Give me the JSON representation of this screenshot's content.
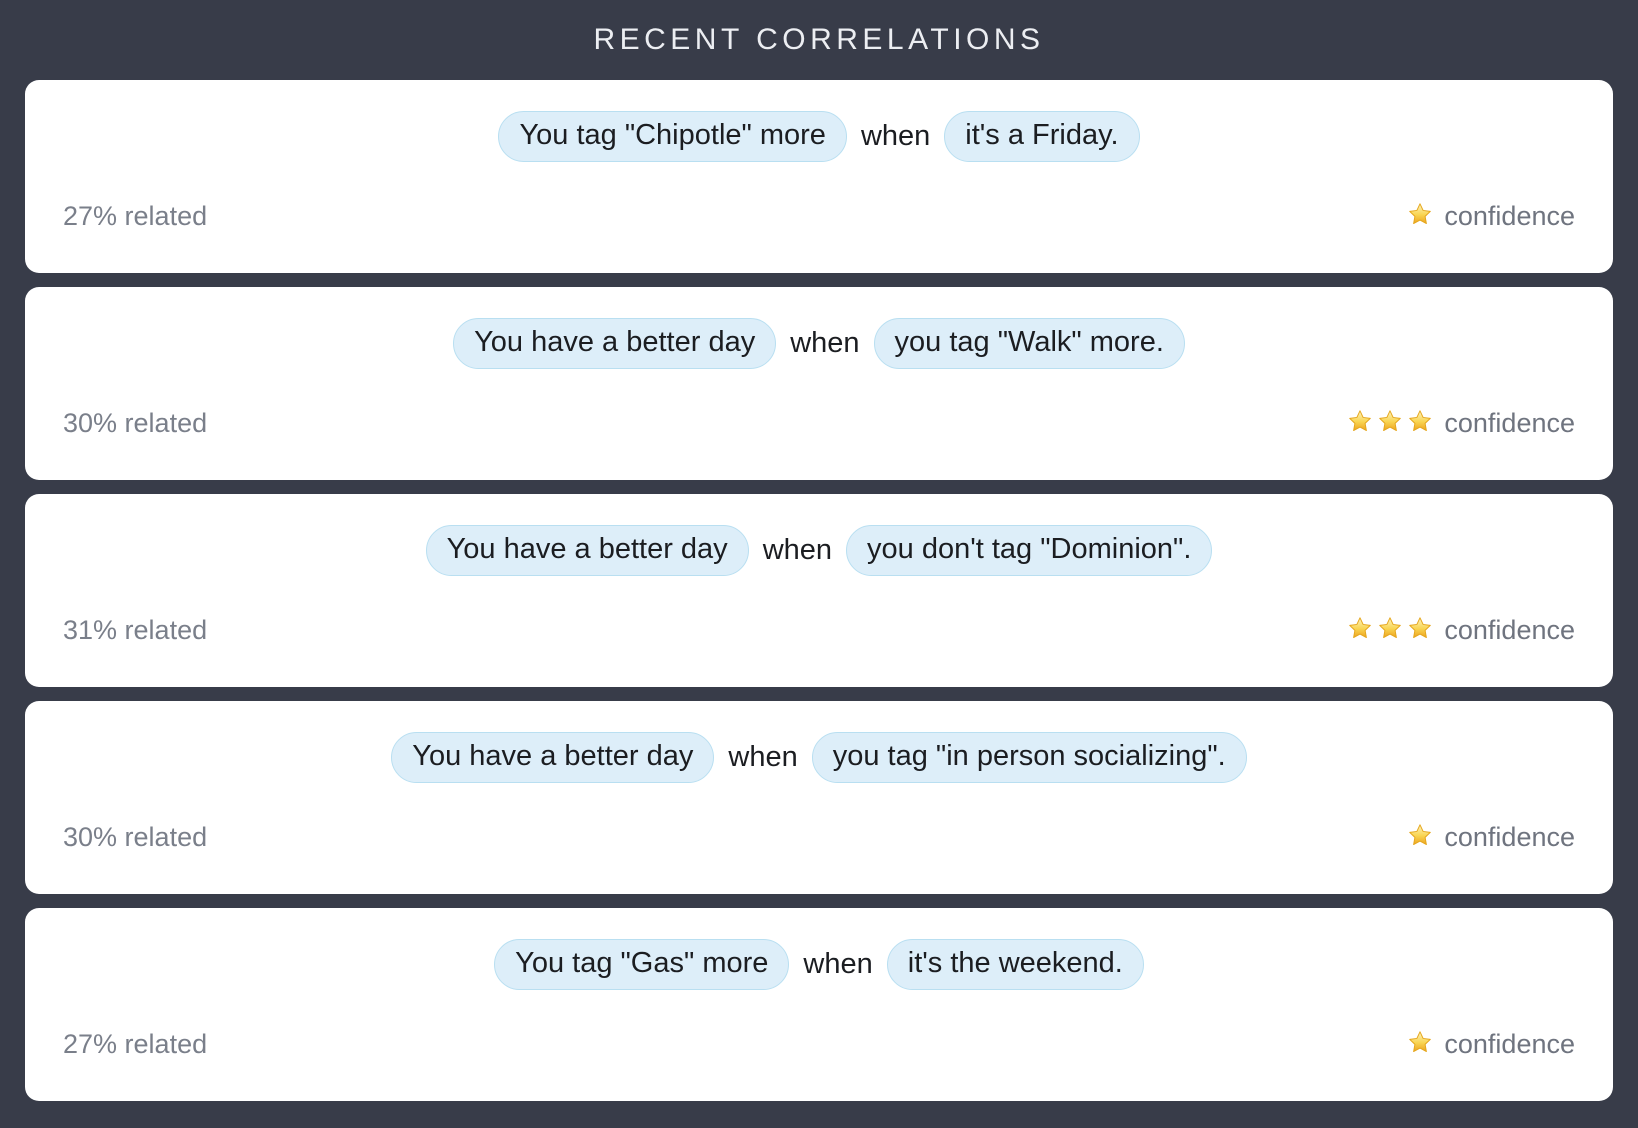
{
  "header": {
    "title": "RECENT CORRELATIONS"
  },
  "labels": {
    "connector": "when",
    "confidence_label": "confidence",
    "star_icon": "star-icon"
  },
  "colors": {
    "background": "#383c49",
    "card": "#ffffff",
    "pill_fill": "#ddeef9",
    "pill_border": "#b9dff1",
    "text": "#1b1d21",
    "muted": "#7a7f8a",
    "star": "#f7c948"
  },
  "correlations": [
    {
      "cause": "You tag \"Chipotle\" more",
      "connector": "when",
      "effect": "it's a Friday.",
      "related": "27% related",
      "related_percent": 27,
      "confidence_stars": 1,
      "confidence_label": "confidence"
    },
    {
      "cause": "You have a better day",
      "connector": "when",
      "effect": "you tag \"Walk\" more.",
      "related": "30% related",
      "related_percent": 30,
      "confidence_stars": 3,
      "confidence_label": "confidence"
    },
    {
      "cause": "You have a better day",
      "connector": "when",
      "effect": "you don't tag \"Dominion\".",
      "related": "31% related",
      "related_percent": 31,
      "confidence_stars": 3,
      "confidence_label": "confidence"
    },
    {
      "cause": "You have a better day",
      "connector": "when",
      "effect": "you tag \"in person socializing\".",
      "related": "30% related",
      "related_percent": 30,
      "confidence_stars": 1,
      "confidence_label": "confidence"
    },
    {
      "cause": "You tag \"Gas\" more",
      "connector": "when",
      "effect": "it's the weekend.",
      "related": "27% related",
      "related_percent": 27,
      "confidence_stars": 1,
      "confidence_label": "confidence"
    }
  ]
}
